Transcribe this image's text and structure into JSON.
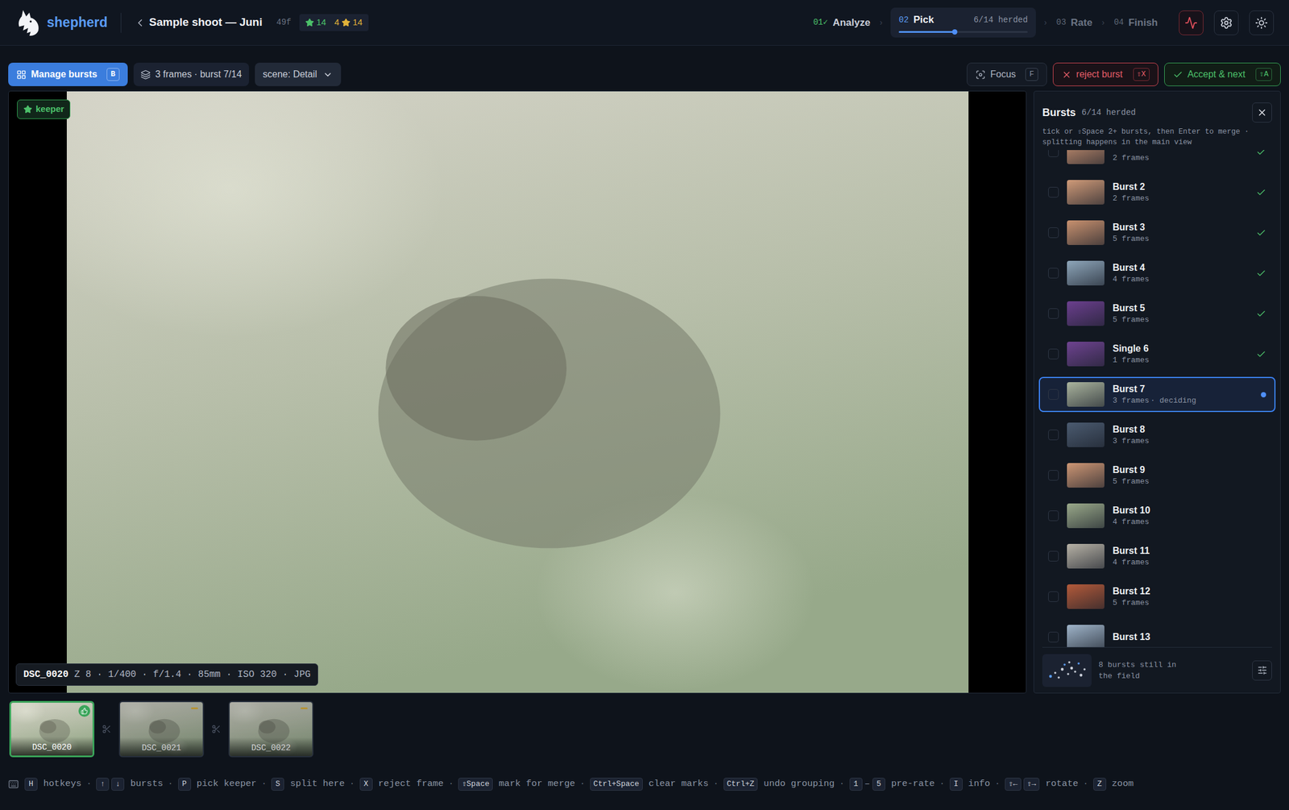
{
  "app": {
    "name": "shepherd"
  },
  "project": {
    "title": "Sample shoot — Juni",
    "count": "49f",
    "keepers": "14",
    "rated_stars": "4",
    "rated_count": "14"
  },
  "step_separator": "›",
  "steps": [
    {
      "num": "01",
      "done_mark": "✓",
      "label": "Analyze",
      "done": true,
      "selected": false
    },
    {
      "num": "02",
      "label": "Pick",
      "progress": "6/14 herded",
      "level": 0.43,
      "done": false,
      "selected": true
    },
    {
      "num": "03",
      "label": "Rate",
      "done": false,
      "selected": false
    },
    {
      "num": "04",
      "label": "Finish",
      "done": false,
      "selected": false
    }
  ],
  "toolbar": {
    "manage": {
      "label": "Manage bursts",
      "key": "B",
      "on": true
    },
    "burst_info": "3 frames · burst 7/14",
    "scene": "scene: Detail",
    "focus": {
      "label": "Focus",
      "key": "F"
    },
    "reject": {
      "label": "reject burst",
      "key": "⇧X"
    },
    "accept": {
      "label": "Accept & next",
      "key": "⇧A"
    }
  },
  "viewer": {
    "badge": "keeper",
    "file": "DSC_0020",
    "exif": "Z 8 · 1/400 · f/1.4 · 85mm · ISO 320 · JPG"
  },
  "panel": {
    "title": "Bursts",
    "progress": "6/14 herded",
    "hint": "tick or ⇧Space 2+ bursts, then Enter to merge · splitting happens in the main view",
    "bursts": [
      {
        "frames": "2 frames",
        "done": true,
        "selected": false,
        "checked": false,
        "color": "#c99272"
      },
      {
        "name": "Burst 2",
        "frames": "2 frames",
        "done": true,
        "selected": false,
        "checked": false,
        "color": "#cf9a78"
      },
      {
        "name": "Burst 3",
        "frames": "5 frames",
        "done": true,
        "selected": false,
        "checked": false,
        "color": "#c8916f"
      },
      {
        "name": "Burst 4",
        "frames": "4 frames",
        "done": true,
        "selected": false,
        "checked": false,
        "color": "#8ea6ba"
      },
      {
        "name": "Burst 5",
        "frames": "5 frames",
        "done": true,
        "selected": false,
        "checked": false,
        "color": "#6b3f8e"
      },
      {
        "name": "Single 6",
        "frames": "1 frames",
        "done": true,
        "selected": false,
        "checked": false,
        "color": "#6e4390"
      },
      {
        "name": "Burst 7",
        "frames": "3 frames",
        "status": "· deciding",
        "done": false,
        "selected": true,
        "checked": false,
        "color": "#aab49e"
      },
      {
        "name": "Burst 8",
        "frames": "3 frames",
        "done": false,
        "selected": false,
        "checked": false,
        "color": "#4b5b70"
      },
      {
        "name": "Burst 9",
        "frames": "5 frames",
        "done": false,
        "selected": false,
        "checked": false,
        "color": "#cd9674"
      },
      {
        "name": "Burst 10",
        "frames": "4 frames",
        "done": false,
        "selected": false,
        "checked": false,
        "color": "#9aa98a"
      },
      {
        "name": "Burst 11",
        "frames": "4 frames",
        "done": false,
        "selected": false,
        "checked": false,
        "color": "#b7b2a6"
      },
      {
        "name": "Burst 12",
        "frames": "5 frames",
        "done": false,
        "selected": false,
        "checked": false,
        "color": "#b35a3a"
      },
      {
        "name": "Burst 13",
        "done": false,
        "selected": false,
        "checked": false,
        "color": "#9fb4c9"
      }
    ],
    "footer": "8 bursts still in the field"
  },
  "filmstrip": [
    {
      "name": "DSC_0020",
      "mark": "keeper",
      "selected": true
    },
    {
      "name": "DSC_0021",
      "mark": "undecided",
      "selected": false
    },
    {
      "name": "DSC_0022",
      "mark": "undecided",
      "selected": false
    }
  ],
  "hotkeys": {
    "separator": "·",
    "items": [
      {
        "keys": [
          "H"
        ],
        "label": "hotkeys"
      },
      {
        "keys": [
          "↑",
          "↓"
        ],
        "label": "bursts"
      },
      {
        "keys": [
          "P"
        ],
        "label": "pick keeper"
      },
      {
        "keys": [
          "S"
        ],
        "label": "split here"
      },
      {
        "keys": [
          "X"
        ],
        "label": "reject frame"
      },
      {
        "keys": [
          "⇧Space"
        ],
        "label": "mark for merge"
      },
      {
        "keys": [
          "Ctrl+Space"
        ],
        "label": "clear marks"
      },
      {
        "keys": [
          "Ctrl+Z"
        ],
        "label": "undo grouping"
      },
      {
        "keys": [
          "1",
          "5"
        ],
        "joiner": "–",
        "label": "pre-rate"
      },
      {
        "keys": [
          "I"
        ],
        "label": "info"
      },
      {
        "keys": [
          "⇧←",
          "⇧→"
        ],
        "label": "rotate"
      },
      {
        "keys": [
          "Z"
        ],
        "label": "zoom"
      }
    ]
  }
}
